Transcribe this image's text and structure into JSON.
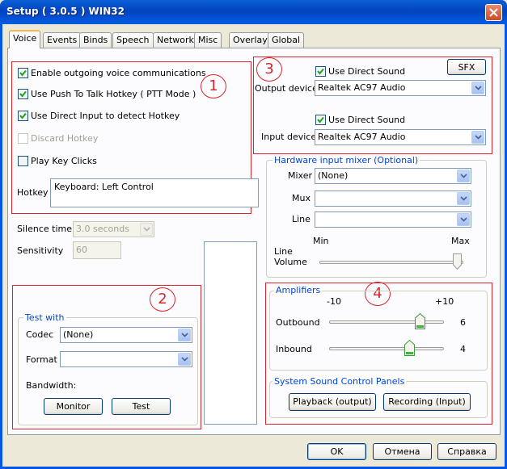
{
  "window": {
    "title": "Setup ( 3.0.5 ) WIN32",
    "close_icon": "close-x-icon"
  },
  "tabs": [
    {
      "label": "Voice",
      "active": true
    },
    {
      "label": "Events"
    },
    {
      "label": "Binds"
    },
    {
      "label": "Speech"
    },
    {
      "label": "Network"
    },
    {
      "label": "Misc"
    },
    {
      "label": "Overlay"
    },
    {
      "label": "Global"
    }
  ],
  "annotations": [
    "1",
    "2",
    "3",
    "4"
  ],
  "voice": {
    "enable_outgoing": {
      "label": "Enable outgoing voice communications",
      "checked": true
    },
    "push_to_talk": {
      "label": "Use Push To Talk Hotkey ( PTT Mode )",
      "checked": true
    },
    "direct_input": {
      "label": "Use Direct Input to detect Hotkey",
      "checked": true
    },
    "discard_hotkey": {
      "label": "Discard Hotkey",
      "checked": false,
      "disabled": true
    },
    "play_key_clicks": {
      "label": "Play Key Clicks",
      "checked": false
    },
    "hotkey_label": "Hotkey",
    "hotkey_value": "Keyboard: Left Control",
    "silence_label": "Silence time",
    "silence_value": "3.0 seconds",
    "sensitivity_label": "Sensitivity",
    "sensitivity_value": "60"
  },
  "test_with": {
    "title": "Test with",
    "codec_label": "Codec",
    "codec_value": "(None)",
    "format_label": "Format",
    "format_value": "",
    "bandwidth_label": "Bandwidth:",
    "monitor_button": "Monitor",
    "test_button": "Test"
  },
  "devices": {
    "sfx_button": "SFX",
    "output_direct_sound": {
      "label": "Use Direct Sound",
      "checked": true
    },
    "output_label": "Output device",
    "output_value": "Realtek AC97 Audio",
    "input_direct_sound": {
      "label": "Use Direct Sound",
      "checked": true
    },
    "input_label": "Input device",
    "input_value": "Realtek AC97 Audio"
  },
  "mixer": {
    "title": "Hardware input mixer (Optional)",
    "mixer_label": "Mixer",
    "mixer_value": "(None)",
    "mux_label": "Mux",
    "mux_value": "",
    "line_label": "Line",
    "line_value": "",
    "min_label": "Min",
    "max_label": "Max",
    "line_volume_label_1": "Line",
    "line_volume_label_2": "Volume",
    "line_volume_level": 1.0
  },
  "amplifiers": {
    "title": "Amplifiers",
    "scale_min": "-10",
    "scale_max": "+10",
    "outbound_label": "Outbound",
    "outbound_value": "6",
    "inbound_label": "Inbound",
    "inbound_value": "4"
  },
  "sound_panels": {
    "title": "System Sound Control Panels",
    "playback_button": "Playback (output)",
    "recording_button": "Recording (Input)"
  },
  "footer": {
    "ok": "OK",
    "cancel": "Отмена",
    "help": "Справка"
  },
  "colors": {
    "annotation_red": "#d8262e",
    "group_title_blue": "#0046d5",
    "xp_titlebar_blue": "#0343c0"
  }
}
